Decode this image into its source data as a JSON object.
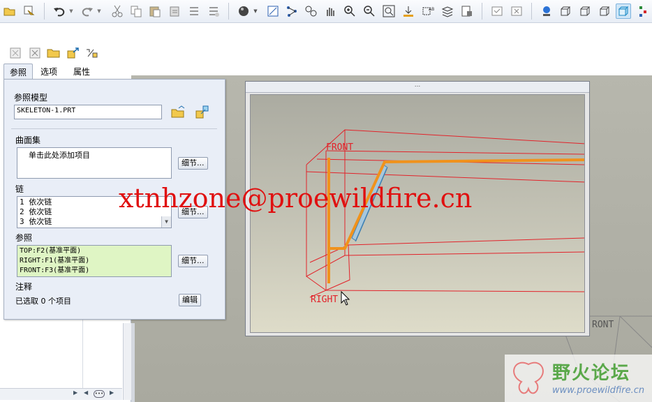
{
  "tabs": [
    {
      "label": "参照"
    },
    {
      "label": "选项"
    },
    {
      "label": "属性"
    }
  ],
  "panel": {
    "ref_model_label": "参照模型",
    "ref_model_value": "SKELETON-1.PRT",
    "surface_set_label": "曲面集",
    "surface_set_placeholder": "单击此处添加项目",
    "detail_button": "细节...",
    "chain_label": "链",
    "chains": [
      "1 依次链",
      "2 依次链",
      "3 依次链"
    ],
    "refs_label": "参照",
    "refs": [
      "TOP:F2(基准平面)",
      "RIGHT:F1(基准平面)",
      "FRONT:F3(基准平面)"
    ],
    "notes_label": "注释",
    "selected_text": "已选取 0 个项目",
    "edit_button": "编辑"
  },
  "preview": {
    "title_dots": "...",
    "datum_labels": {
      "front": "FRONT",
      "right": "RIGHT"
    }
  },
  "graphics": {
    "bg_datum_label": "RONT"
  },
  "watermark": "xtnhzone@proewildfire.cn",
  "forum_logo": {
    "name": "野火论坛",
    "url": "www.proewildfire.cn"
  },
  "colors": {
    "accent_orange": "#f0921c",
    "datum_red": "#e2232a",
    "watermark_red": "#e01010",
    "ref_list_bg": "#dff5c4",
    "logo_green": "#5aa84a"
  }
}
